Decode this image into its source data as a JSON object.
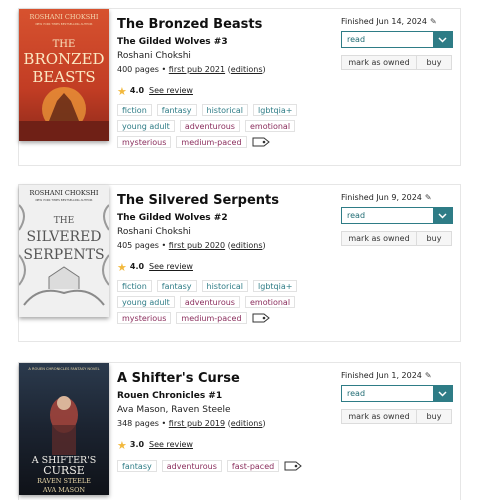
{
  "books": [
    {
      "title": "The Bronzed Beasts",
      "series": "The Gilded Wolves #3",
      "author": "Roshani Chokshi",
      "pages": "400 pages",
      "pub_link": "first pub 2021",
      "editions": "editions",
      "rating": "4.0",
      "see_review": "See review",
      "tags": [
        {
          "label": "fiction",
          "kind": "teal"
        },
        {
          "label": "fantasy",
          "kind": "teal"
        },
        {
          "label": "historical",
          "kind": "teal"
        },
        {
          "label": "lgbtqia+",
          "kind": "teal"
        },
        {
          "label": "young adult",
          "kind": "teal"
        },
        {
          "label": "adventurous",
          "kind": "plum"
        },
        {
          "label": "emotional",
          "kind": "plum"
        },
        {
          "label": "mysterious",
          "kind": "plum"
        },
        {
          "label": "medium-paced",
          "kind": "plum"
        }
      ],
      "finished": "Finished Jun 14, 2024",
      "status": "read",
      "mark_owned": "mark as owned",
      "buy": "buy",
      "cover": {
        "author_text": "ROSHANI CHOKSHI",
        "blurb": "NEW YORK TIMES BESTSELLING AUTHOR",
        "title_line1": "THE",
        "title_line2": "BRONZED",
        "title_line3": "BEASTS",
        "bg": "#c9462a"
      }
    },
    {
      "title": "The Silvered Serpents",
      "series": "The Gilded Wolves #2",
      "author": "Roshani Chokshi",
      "pages": "405 pages",
      "pub_link": "first pub 2020",
      "editions": "editions",
      "rating": "4.0",
      "see_review": "See review",
      "tags": [
        {
          "label": "fiction",
          "kind": "teal"
        },
        {
          "label": "fantasy",
          "kind": "teal"
        },
        {
          "label": "historical",
          "kind": "teal"
        },
        {
          "label": "lgbtqia+",
          "kind": "teal"
        },
        {
          "label": "young adult",
          "kind": "teal"
        },
        {
          "label": "adventurous",
          "kind": "plum"
        },
        {
          "label": "emotional",
          "kind": "plum"
        },
        {
          "label": "mysterious",
          "kind": "plum"
        },
        {
          "label": "medium-paced",
          "kind": "plum"
        }
      ],
      "finished": "Finished Jun 9, 2024",
      "status": "read",
      "mark_owned": "mark as owned",
      "buy": "buy",
      "cover": {
        "author_text": "ROSHANI CHOKSHI",
        "blurb": "NEW YORK TIMES BESTSELLING AUTHOR",
        "title_line1": "THE",
        "title_line2": "SILVERED",
        "title_line3": "SERPENTS",
        "bg": "#eeeeee"
      }
    },
    {
      "title": "A Shifter's Curse",
      "series": "Rouen Chronicles #1",
      "author": "Ava Mason, Raven Steele",
      "pages": "348 pages",
      "pub_link": "first pub 2019",
      "editions": "editions",
      "rating": "3.0",
      "see_review": "See review",
      "tags": [
        {
          "label": "fantasy",
          "kind": "teal"
        },
        {
          "label": "adventurous",
          "kind": "plum"
        },
        {
          "label": "fast-paced",
          "kind": "plum"
        }
      ],
      "finished": "Finished Jun 1, 2024",
      "status": "read",
      "mark_owned": "mark as owned",
      "buy": "buy",
      "cover": {
        "author_text": "A ROUEN CHRONICLES FANTASY NOVEL",
        "title_line1": "A SHIFTER'S",
        "title_line2": "CURSE",
        "authors_line1": "RAVEN STEELE",
        "authors_line2": "AVA MASON",
        "bg": "#1d2530"
      }
    }
  ],
  "colors": {
    "accent": "#2e7c86",
    "tag_teal": "#2e7c86",
    "tag_plum": "#8a2d5c",
    "star": "#f2b83c"
  },
  "icons": {
    "edit": "pencil-icon",
    "dropdown": "chevron-down-icon",
    "more_tags": "tag-icon",
    "rating": "star-icon"
  }
}
